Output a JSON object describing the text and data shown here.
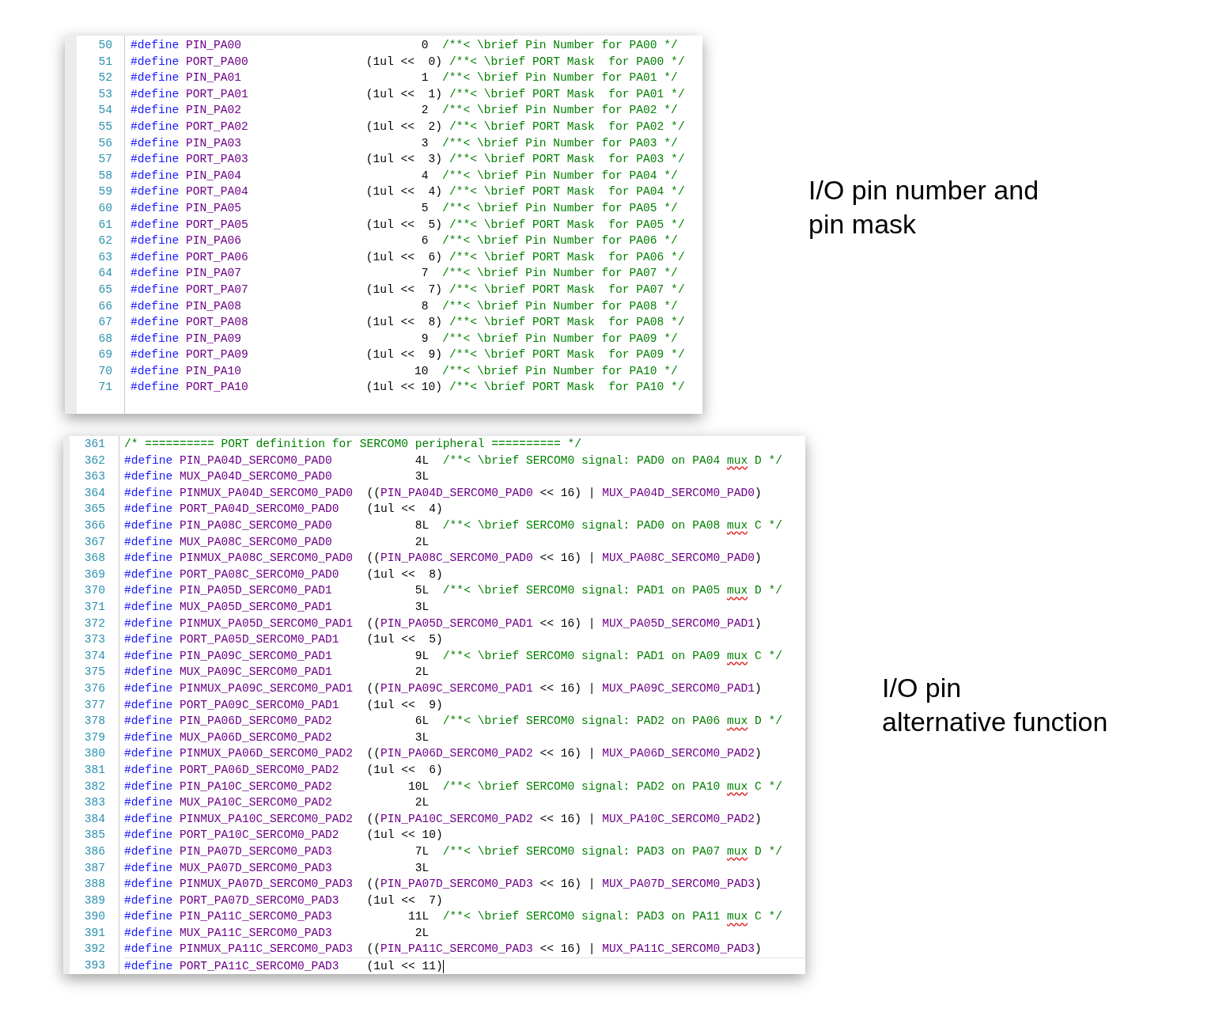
{
  "editors": [
    {
      "annotation": "I/O pin number and\npin mask",
      "lines": [
        {
          "number": "50",
          "parts": [
            {
              "kind": "keyword",
              "text": "#define "
            },
            {
              "kind": "macro",
              "text": "PIN_PA00"
            },
            {
              "kind": "plain",
              "text": "                          0  "
            },
            {
              "kind": "comment",
              "text": "/**< \\brief Pin Number for PA00 */"
            }
          ]
        },
        {
          "number": "51",
          "parts": [
            {
              "kind": "keyword",
              "text": "#define "
            },
            {
              "kind": "macro",
              "text": "PORT_PA00"
            },
            {
              "kind": "plain",
              "text": "                 (1ul <<  0) "
            },
            {
              "kind": "comment",
              "text": "/**< \\brief PORT Mask  for PA00 */"
            }
          ]
        },
        {
          "number": "52",
          "parts": [
            {
              "kind": "keyword",
              "text": "#define "
            },
            {
              "kind": "macro",
              "text": "PIN_PA01"
            },
            {
              "kind": "plain",
              "text": "                          1  "
            },
            {
              "kind": "comment",
              "text": "/**< \\brief Pin Number for PA01 */"
            }
          ]
        },
        {
          "number": "53",
          "parts": [
            {
              "kind": "keyword",
              "text": "#define "
            },
            {
              "kind": "macro",
              "text": "PORT_PA01"
            },
            {
              "kind": "plain",
              "text": "                 (1ul <<  1) "
            },
            {
              "kind": "comment",
              "text": "/**< \\brief PORT Mask  for PA01 */"
            }
          ]
        },
        {
          "number": "54",
          "parts": [
            {
              "kind": "keyword",
              "text": "#define "
            },
            {
              "kind": "macro",
              "text": "PIN_PA02"
            },
            {
              "kind": "plain",
              "text": "                          2  "
            },
            {
              "kind": "comment",
              "text": "/**< \\brief Pin Number for PA02 */"
            }
          ]
        },
        {
          "number": "55",
          "parts": [
            {
              "kind": "keyword",
              "text": "#define "
            },
            {
              "kind": "macro",
              "text": "PORT_PA02"
            },
            {
              "kind": "plain",
              "text": "                 (1ul <<  2) "
            },
            {
              "kind": "comment",
              "text": "/**< \\brief PORT Mask  for PA02 */"
            }
          ]
        },
        {
          "number": "56",
          "parts": [
            {
              "kind": "keyword",
              "text": "#define "
            },
            {
              "kind": "macro",
              "text": "PIN_PA03"
            },
            {
              "kind": "plain",
              "text": "                          3  "
            },
            {
              "kind": "comment",
              "text": "/**< \\brief Pin Number for PA03 */"
            }
          ]
        },
        {
          "number": "57",
          "parts": [
            {
              "kind": "keyword",
              "text": "#define "
            },
            {
              "kind": "macro",
              "text": "PORT_PA03"
            },
            {
              "kind": "plain",
              "text": "                 (1ul <<  3) "
            },
            {
              "kind": "comment",
              "text": "/**< \\brief PORT Mask  for PA03 */"
            }
          ]
        },
        {
          "number": "58",
          "parts": [
            {
              "kind": "keyword",
              "text": "#define "
            },
            {
              "kind": "macro",
              "text": "PIN_PA04"
            },
            {
              "kind": "plain",
              "text": "                          4  "
            },
            {
              "kind": "comment",
              "text": "/**< \\brief Pin Number for PA04 */"
            }
          ]
        },
        {
          "number": "59",
          "parts": [
            {
              "kind": "keyword",
              "text": "#define "
            },
            {
              "kind": "macro",
              "text": "PORT_PA04"
            },
            {
              "kind": "plain",
              "text": "                 (1ul <<  4) "
            },
            {
              "kind": "comment",
              "text": "/**< \\brief PORT Mask  for PA04 */"
            }
          ]
        },
        {
          "number": "60",
          "parts": [
            {
              "kind": "keyword",
              "text": "#define "
            },
            {
              "kind": "macro",
              "text": "PIN_PA05"
            },
            {
              "kind": "plain",
              "text": "                          5  "
            },
            {
              "kind": "comment",
              "text": "/**< \\brief Pin Number for PA05 */"
            }
          ]
        },
        {
          "number": "61",
          "parts": [
            {
              "kind": "keyword",
              "text": "#define "
            },
            {
              "kind": "macro",
              "text": "PORT_PA05"
            },
            {
              "kind": "plain",
              "text": "                 (1ul <<  5) "
            },
            {
              "kind": "comment",
              "text": "/**< \\brief PORT Mask  for PA05 */"
            }
          ]
        },
        {
          "number": "62",
          "parts": [
            {
              "kind": "keyword",
              "text": "#define "
            },
            {
              "kind": "macro",
              "text": "PIN_PA06"
            },
            {
              "kind": "plain",
              "text": "                          6  "
            },
            {
              "kind": "comment",
              "text": "/**< \\brief Pin Number for PA06 */"
            }
          ]
        },
        {
          "number": "63",
          "parts": [
            {
              "kind": "keyword",
              "text": "#define "
            },
            {
              "kind": "macro",
              "text": "PORT_PA06"
            },
            {
              "kind": "plain",
              "text": "                 (1ul <<  6) "
            },
            {
              "kind": "comment",
              "text": "/**< \\brief PORT Mask  for PA06 */"
            }
          ]
        },
        {
          "number": "64",
          "parts": [
            {
              "kind": "keyword",
              "text": "#define "
            },
            {
              "kind": "macro",
              "text": "PIN_PA07"
            },
            {
              "kind": "plain",
              "text": "                          7  "
            },
            {
              "kind": "comment",
              "text": "/**< \\brief Pin Number for PA07 */"
            }
          ]
        },
        {
          "number": "65",
          "parts": [
            {
              "kind": "keyword",
              "text": "#define "
            },
            {
              "kind": "macro",
              "text": "PORT_PA07"
            },
            {
              "kind": "plain",
              "text": "                 (1ul <<  7) "
            },
            {
              "kind": "comment",
              "text": "/**< \\brief PORT Mask  for PA07 */"
            }
          ]
        },
        {
          "number": "66",
          "parts": [
            {
              "kind": "keyword",
              "text": "#define "
            },
            {
              "kind": "macro",
              "text": "PIN_PA08"
            },
            {
              "kind": "plain",
              "text": "                          8  "
            },
            {
              "kind": "comment",
              "text": "/**< \\brief Pin Number for PA08 */"
            }
          ]
        },
        {
          "number": "67",
          "parts": [
            {
              "kind": "keyword",
              "text": "#define "
            },
            {
              "kind": "macro",
              "text": "PORT_PA08"
            },
            {
              "kind": "plain",
              "text": "                 (1ul <<  8) "
            },
            {
              "kind": "comment",
              "text": "/**< \\brief PORT Mask  for PA08 */"
            }
          ]
        },
        {
          "number": "68",
          "parts": [
            {
              "kind": "keyword",
              "text": "#define "
            },
            {
              "kind": "macro",
              "text": "PIN_PA09"
            },
            {
              "kind": "plain",
              "text": "                          9  "
            },
            {
              "kind": "comment",
              "text": "/**< \\brief Pin Number for PA09 */"
            }
          ]
        },
        {
          "number": "69",
          "parts": [
            {
              "kind": "keyword",
              "text": "#define "
            },
            {
              "kind": "macro",
              "text": "PORT_PA09"
            },
            {
              "kind": "plain",
              "text": "                 (1ul <<  9) "
            },
            {
              "kind": "comment",
              "text": "/**< \\brief PORT Mask  for PA09 */"
            }
          ]
        },
        {
          "number": "70",
          "parts": [
            {
              "kind": "keyword",
              "text": "#define "
            },
            {
              "kind": "macro",
              "text": "PIN_PA10"
            },
            {
              "kind": "plain",
              "text": "                         10  "
            },
            {
              "kind": "comment",
              "text": "/**< \\brief Pin Number for PA10 */"
            }
          ]
        },
        {
          "number": "71",
          "parts": [
            {
              "kind": "keyword",
              "text": "#define "
            },
            {
              "kind": "macro",
              "text": "PORT_PA10"
            },
            {
              "kind": "plain",
              "text": "                 (1ul << 10) "
            },
            {
              "kind": "comment",
              "text": "/**< \\brief PORT Mask  for PA10 */"
            }
          ]
        }
      ]
    },
    {
      "annotation": "I/O pin\nalternative function",
      "lines": [
        {
          "number": "361",
          "current": false,
          "parts": [
            {
              "kind": "comment",
              "text": "/* ========== PORT definition for SERCOM0 peripheral ========== */"
            }
          ]
        },
        {
          "number": "362",
          "current": false,
          "parts": [
            {
              "kind": "keyword",
              "text": "#define "
            },
            {
              "kind": "macro",
              "text": "PIN_PA04D_SERCOM0_PAD0"
            },
            {
              "kind": "plain",
              "text": "            4L  "
            },
            {
              "kind": "comment",
              "text": "/**< \\brief SERCOM0 signal: PAD0 on PA04 "
            },
            {
              "kind": "misspelled",
              "text": "mux"
            },
            {
              "kind": "comment",
              "text": " D */"
            }
          ]
        },
        {
          "number": "363",
          "current": false,
          "parts": [
            {
              "kind": "keyword",
              "text": "#define "
            },
            {
              "kind": "macro",
              "text": "MUX_PA04D_SERCOM0_PAD0"
            },
            {
              "kind": "plain",
              "text": "            3L"
            }
          ]
        },
        {
          "number": "364",
          "current": false,
          "parts": [
            {
              "kind": "keyword",
              "text": "#define "
            },
            {
              "kind": "macro",
              "text": "PINMUX_PA04D_SERCOM0_PAD0"
            },
            {
              "kind": "plain",
              "text": "  (("
            },
            {
              "kind": "macro",
              "text": "PIN_PA04D_SERCOM0_PAD0"
            },
            {
              "kind": "plain",
              "text": " << 16) | "
            },
            {
              "kind": "macro",
              "text": "MUX_PA04D_SERCOM0_PAD0"
            },
            {
              "kind": "plain",
              "text": ")"
            }
          ]
        },
        {
          "number": "365",
          "current": false,
          "parts": [
            {
              "kind": "keyword",
              "text": "#define "
            },
            {
              "kind": "macro",
              "text": "PORT_PA04D_SERCOM0_PAD0"
            },
            {
              "kind": "plain",
              "text": "    (1ul <<  4)"
            }
          ]
        },
        {
          "number": "366",
          "current": false,
          "parts": [
            {
              "kind": "keyword",
              "text": "#define "
            },
            {
              "kind": "macro",
              "text": "PIN_PA08C_SERCOM0_PAD0"
            },
            {
              "kind": "plain",
              "text": "            8L  "
            },
            {
              "kind": "comment",
              "text": "/**< \\brief SERCOM0 signal: PAD0 on PA08 "
            },
            {
              "kind": "misspelled",
              "text": "mux"
            },
            {
              "kind": "comment",
              "text": " C */"
            }
          ]
        },
        {
          "number": "367",
          "current": false,
          "parts": [
            {
              "kind": "keyword",
              "text": "#define "
            },
            {
              "kind": "macro",
              "text": "MUX_PA08C_SERCOM0_PAD0"
            },
            {
              "kind": "plain",
              "text": "            2L"
            }
          ]
        },
        {
          "number": "368",
          "current": false,
          "parts": [
            {
              "kind": "keyword",
              "text": "#define "
            },
            {
              "kind": "macro",
              "text": "PINMUX_PA08C_SERCOM0_PAD0"
            },
            {
              "kind": "plain",
              "text": "  (("
            },
            {
              "kind": "macro",
              "text": "PIN_PA08C_SERCOM0_PAD0"
            },
            {
              "kind": "plain",
              "text": " << 16) | "
            },
            {
              "kind": "macro",
              "text": "MUX_PA08C_SERCOM0_PAD0"
            },
            {
              "kind": "plain",
              "text": ")"
            }
          ]
        },
        {
          "number": "369",
          "current": false,
          "parts": [
            {
              "kind": "keyword",
              "text": "#define "
            },
            {
              "kind": "macro",
              "text": "PORT_PA08C_SERCOM0_PAD0"
            },
            {
              "kind": "plain",
              "text": "    (1ul <<  8)"
            }
          ]
        },
        {
          "number": "370",
          "current": false,
          "parts": [
            {
              "kind": "keyword",
              "text": "#define "
            },
            {
              "kind": "macro",
              "text": "PIN_PA05D_SERCOM0_PAD1"
            },
            {
              "kind": "plain",
              "text": "            5L  "
            },
            {
              "kind": "comment",
              "text": "/**< \\brief SERCOM0 signal: PAD1 on PA05 "
            },
            {
              "kind": "misspelled",
              "text": "mux"
            },
            {
              "kind": "comment",
              "text": " D */"
            }
          ]
        },
        {
          "number": "371",
          "current": false,
          "parts": [
            {
              "kind": "keyword",
              "text": "#define "
            },
            {
              "kind": "macro",
              "text": "MUX_PA05D_SERCOM0_PAD1"
            },
            {
              "kind": "plain",
              "text": "            3L"
            }
          ]
        },
        {
          "number": "372",
          "current": false,
          "parts": [
            {
              "kind": "keyword",
              "text": "#define "
            },
            {
              "kind": "macro",
              "text": "PINMUX_PA05D_SERCOM0_PAD1"
            },
            {
              "kind": "plain",
              "text": "  (("
            },
            {
              "kind": "macro",
              "text": "PIN_PA05D_SERCOM0_PAD1"
            },
            {
              "kind": "plain",
              "text": " << 16) | "
            },
            {
              "kind": "macro",
              "text": "MUX_PA05D_SERCOM0_PAD1"
            },
            {
              "kind": "plain",
              "text": ")"
            }
          ]
        },
        {
          "number": "373",
          "current": false,
          "parts": [
            {
              "kind": "keyword",
              "text": "#define "
            },
            {
              "kind": "macro",
              "text": "PORT_PA05D_SERCOM0_PAD1"
            },
            {
              "kind": "plain",
              "text": "    (1ul <<  5)"
            }
          ]
        },
        {
          "number": "374",
          "current": false,
          "parts": [
            {
              "kind": "keyword",
              "text": "#define "
            },
            {
              "kind": "macro",
              "text": "PIN_PA09C_SERCOM0_PAD1"
            },
            {
              "kind": "plain",
              "text": "            9L  "
            },
            {
              "kind": "comment",
              "text": "/**< \\brief SERCOM0 signal: PAD1 on PA09 "
            },
            {
              "kind": "misspelled",
              "text": "mux"
            },
            {
              "kind": "comment",
              "text": " C */"
            }
          ]
        },
        {
          "number": "375",
          "current": false,
          "parts": [
            {
              "kind": "keyword",
              "text": "#define "
            },
            {
              "kind": "macro",
              "text": "MUX_PA09C_SERCOM0_PAD1"
            },
            {
              "kind": "plain",
              "text": "            2L"
            }
          ]
        },
        {
          "number": "376",
          "current": false,
          "parts": [
            {
              "kind": "keyword",
              "text": "#define "
            },
            {
              "kind": "macro",
              "text": "PINMUX_PA09C_SERCOM0_PAD1"
            },
            {
              "kind": "plain",
              "text": "  (("
            },
            {
              "kind": "macro",
              "text": "PIN_PA09C_SERCOM0_PAD1"
            },
            {
              "kind": "plain",
              "text": " << 16) | "
            },
            {
              "kind": "macro",
              "text": "MUX_PA09C_SERCOM0_PAD1"
            },
            {
              "kind": "plain",
              "text": ")"
            }
          ]
        },
        {
          "number": "377",
          "current": false,
          "parts": [
            {
              "kind": "keyword",
              "text": "#define "
            },
            {
              "kind": "macro",
              "text": "PORT_PA09C_SERCOM0_PAD1"
            },
            {
              "kind": "plain",
              "text": "    (1ul <<  9)"
            }
          ]
        },
        {
          "number": "378",
          "current": false,
          "parts": [
            {
              "kind": "keyword",
              "text": "#define "
            },
            {
              "kind": "macro",
              "text": "PIN_PA06D_SERCOM0_PAD2"
            },
            {
              "kind": "plain",
              "text": "            6L  "
            },
            {
              "kind": "comment",
              "text": "/**< \\brief SERCOM0 signal: PAD2 on PA06 "
            },
            {
              "kind": "misspelled",
              "text": "mux"
            },
            {
              "kind": "comment",
              "text": " D */"
            }
          ]
        },
        {
          "number": "379",
          "current": false,
          "parts": [
            {
              "kind": "keyword",
              "text": "#define "
            },
            {
              "kind": "macro",
              "text": "MUX_PA06D_SERCOM0_PAD2"
            },
            {
              "kind": "plain",
              "text": "            3L"
            }
          ]
        },
        {
          "number": "380",
          "current": false,
          "parts": [
            {
              "kind": "keyword",
              "text": "#define "
            },
            {
              "kind": "macro",
              "text": "PINMUX_PA06D_SERCOM0_PAD2"
            },
            {
              "kind": "plain",
              "text": "  (("
            },
            {
              "kind": "macro",
              "text": "PIN_PA06D_SERCOM0_PAD2"
            },
            {
              "kind": "plain",
              "text": " << 16) | "
            },
            {
              "kind": "macro",
              "text": "MUX_PA06D_SERCOM0_PAD2"
            },
            {
              "kind": "plain",
              "text": ")"
            }
          ]
        },
        {
          "number": "381",
          "current": false,
          "parts": [
            {
              "kind": "keyword",
              "text": "#define "
            },
            {
              "kind": "macro",
              "text": "PORT_PA06D_SERCOM0_PAD2"
            },
            {
              "kind": "plain",
              "text": "    (1ul <<  6)"
            }
          ]
        },
        {
          "number": "382",
          "current": false,
          "parts": [
            {
              "kind": "keyword",
              "text": "#define "
            },
            {
              "kind": "macro",
              "text": "PIN_PA10C_SERCOM0_PAD2"
            },
            {
              "kind": "plain",
              "text": "           10L  "
            },
            {
              "kind": "comment",
              "text": "/**< \\brief SERCOM0 signal: PAD2 on PA10 "
            },
            {
              "kind": "misspelled",
              "text": "mux"
            },
            {
              "kind": "comment",
              "text": " C */"
            }
          ]
        },
        {
          "number": "383",
          "current": false,
          "parts": [
            {
              "kind": "keyword",
              "text": "#define "
            },
            {
              "kind": "macro",
              "text": "MUX_PA10C_SERCOM0_PAD2"
            },
            {
              "kind": "plain",
              "text": "            2L"
            }
          ]
        },
        {
          "number": "384",
          "current": false,
          "parts": [
            {
              "kind": "keyword",
              "text": "#define "
            },
            {
              "kind": "macro",
              "text": "PINMUX_PA10C_SERCOM0_PAD2"
            },
            {
              "kind": "plain",
              "text": "  (("
            },
            {
              "kind": "macro",
              "text": "PIN_PA10C_SERCOM0_PAD2"
            },
            {
              "kind": "plain",
              "text": " << 16) | "
            },
            {
              "kind": "macro",
              "text": "MUX_PA10C_SERCOM0_PAD2"
            },
            {
              "kind": "plain",
              "text": ")"
            }
          ]
        },
        {
          "number": "385",
          "current": false,
          "parts": [
            {
              "kind": "keyword",
              "text": "#define "
            },
            {
              "kind": "macro",
              "text": "PORT_PA10C_SERCOM0_PAD2"
            },
            {
              "kind": "plain",
              "text": "    (1ul << 10)"
            }
          ]
        },
        {
          "number": "386",
          "current": false,
          "parts": [
            {
              "kind": "keyword",
              "text": "#define "
            },
            {
              "kind": "macro",
              "text": "PIN_PA07D_SERCOM0_PAD3"
            },
            {
              "kind": "plain",
              "text": "            7L  "
            },
            {
              "kind": "comment",
              "text": "/**< \\brief SERCOM0 signal: PAD3 on PA07 "
            },
            {
              "kind": "misspelled",
              "text": "mux"
            },
            {
              "kind": "comment",
              "text": " D */"
            }
          ]
        },
        {
          "number": "387",
          "current": false,
          "parts": [
            {
              "kind": "keyword",
              "text": "#define "
            },
            {
              "kind": "macro",
              "text": "MUX_PA07D_SERCOM0_PAD3"
            },
            {
              "kind": "plain",
              "text": "            3L"
            }
          ]
        },
        {
          "number": "388",
          "current": false,
          "parts": [
            {
              "kind": "keyword",
              "text": "#define "
            },
            {
              "kind": "macro",
              "text": "PINMUX_PA07D_SERCOM0_PAD3"
            },
            {
              "kind": "plain",
              "text": "  (("
            },
            {
              "kind": "macro",
              "text": "PIN_PA07D_SERCOM0_PAD3"
            },
            {
              "kind": "plain",
              "text": " << 16) | "
            },
            {
              "kind": "macro",
              "text": "MUX_PA07D_SERCOM0_PAD3"
            },
            {
              "kind": "plain",
              "text": ")"
            }
          ]
        },
        {
          "number": "389",
          "current": false,
          "parts": [
            {
              "kind": "keyword",
              "text": "#define "
            },
            {
              "kind": "macro",
              "text": "PORT_PA07D_SERCOM0_PAD3"
            },
            {
              "kind": "plain",
              "text": "    (1ul <<  7)"
            }
          ]
        },
        {
          "number": "390",
          "current": false,
          "parts": [
            {
              "kind": "keyword",
              "text": "#define "
            },
            {
              "kind": "macro",
              "text": "PIN_PA11C_SERCOM0_PAD3"
            },
            {
              "kind": "plain",
              "text": "           11L  "
            },
            {
              "kind": "comment",
              "text": "/**< \\brief SERCOM0 signal: PAD3 on PA11 "
            },
            {
              "kind": "misspelled",
              "text": "mux"
            },
            {
              "kind": "comment",
              "text": " C */"
            }
          ]
        },
        {
          "number": "391",
          "current": false,
          "parts": [
            {
              "kind": "keyword",
              "text": "#define "
            },
            {
              "kind": "macro",
              "text": "MUX_PA11C_SERCOM0_PAD3"
            },
            {
              "kind": "plain",
              "text": "            2L"
            }
          ]
        },
        {
          "number": "392",
          "current": false,
          "parts": [
            {
              "kind": "keyword",
              "text": "#define "
            },
            {
              "kind": "macro",
              "text": "PINMUX_PA11C_SERCOM0_PAD3"
            },
            {
              "kind": "plain",
              "text": "  (("
            },
            {
              "kind": "macro",
              "text": "PIN_PA11C_SERCOM0_PAD3"
            },
            {
              "kind": "plain",
              "text": " << 16) | "
            },
            {
              "kind": "macro",
              "text": "MUX_PA11C_SERCOM0_PAD3"
            },
            {
              "kind": "plain",
              "text": ")"
            }
          ]
        },
        {
          "number": "393",
          "current": true,
          "parts": [
            {
              "kind": "keyword",
              "text": "#define "
            },
            {
              "kind": "macro",
              "text": "PORT_PA11C_SERCOM0_PAD3"
            },
            {
              "kind": "plain",
              "text": "    (1ul << 11)"
            }
          ]
        }
      ]
    }
  ]
}
